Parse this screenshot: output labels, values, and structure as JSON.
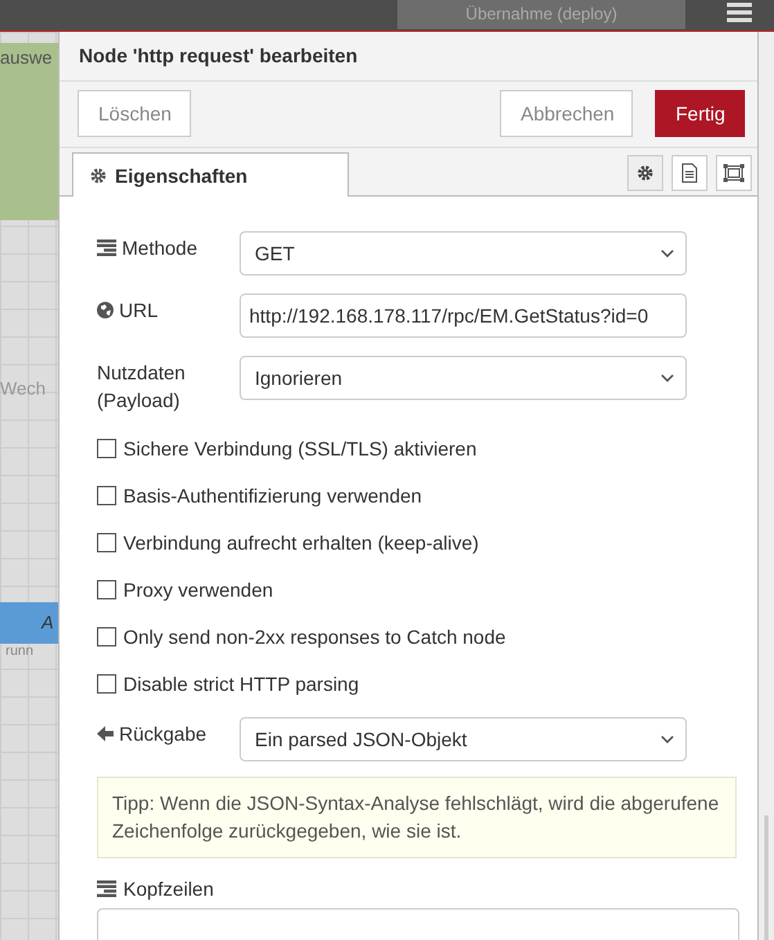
{
  "topbar": {
    "deploy_label": "Übernahme (deploy)"
  },
  "canvas": {
    "nodes": [
      {
        "kind": "green",
        "label": "auswe"
      },
      {
        "kind": "plain",
        "label": "Wech"
      },
      {
        "kind": "blue",
        "label": "A",
        "status": "runn"
      }
    ]
  },
  "dialog": {
    "title": "Node 'http request' bearbeiten",
    "buttons": [
      {
        "kind": "delete",
        "label": "Löschen"
      },
      {
        "kind": "cancel",
        "label": "Abbrechen"
      },
      {
        "kind": "primary",
        "label": "Fertig"
      }
    ],
    "tabs": [
      {
        "label": "Eigenschaften",
        "selected": true
      }
    ],
    "tab_icons": [
      {
        "kind": "gear",
        "selected": true
      },
      {
        "kind": "doc",
        "selected": false
      },
      {
        "kind": "frame",
        "selected": false
      }
    ],
    "fields": [
      {
        "label": "Methode",
        "kind": "select",
        "value": "GET"
      },
      {
        "label": "URL",
        "kind": "input",
        "value": "http://192.168.178.117/rpc/EM.GetStatus?id=0"
      },
      {
        "label": "Nutzdaten (Payload)",
        "kind": "select",
        "value": "Ignorieren"
      }
    ],
    "options": [
      {
        "label": "Sichere Verbindung (SSL/TLS) aktivieren",
        "checked": false
      },
      {
        "label": "Basis-Authentifizierung verwenden",
        "checked": false
      },
      {
        "label": "Verbindung aufrecht erhalten (keep-alive)",
        "checked": false
      },
      {
        "label": "Proxy verwenden",
        "checked": false
      },
      {
        "label": "Only send non-2xx responses to Catch node",
        "checked": false
      },
      {
        "label": "Disable strict HTTP parsing",
        "checked": false
      }
    ],
    "return": {
      "label": "Rückgabe",
      "kind": "select",
      "value": "Ein parsed JSON-Objekt"
    },
    "tip": "Tipp: Wenn die JSON-Syntax-Analyse fehlschlägt, wird die abgerufene Zeichenfolge zurückgegeben, wie sie ist.",
    "headers_label": "Kopfzeilen"
  }
}
